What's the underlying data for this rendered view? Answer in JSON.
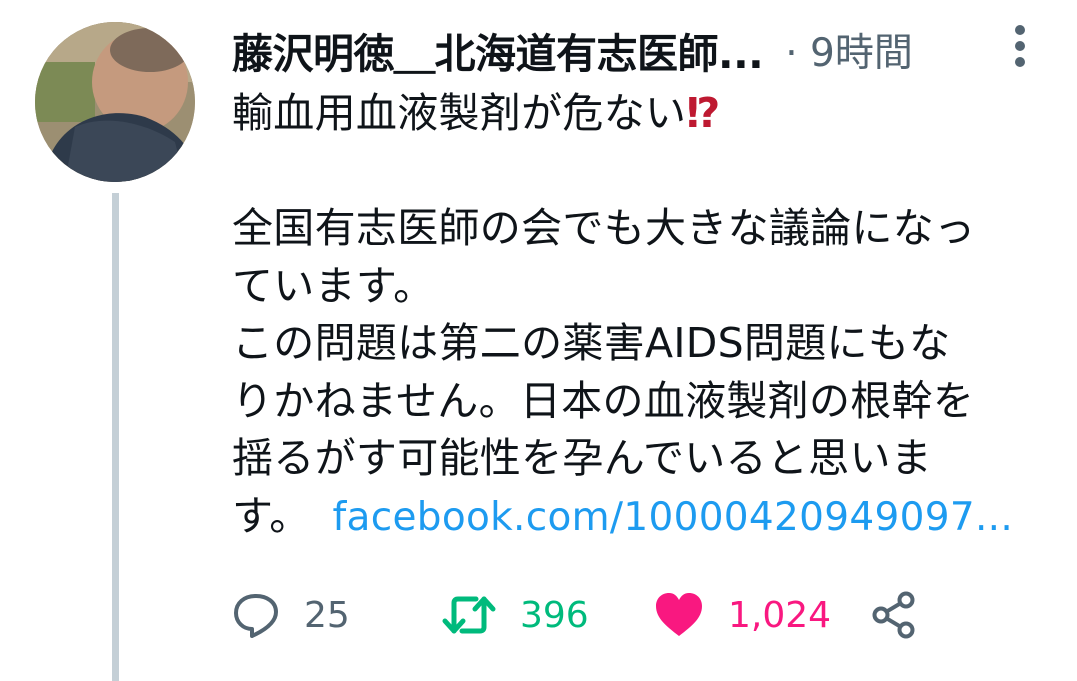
{
  "tweet": {
    "author_name": "藤沢明徳＿北海道有志医師...",
    "time": "· 9時間",
    "text_line1": "輸血用血液製剤が危ない",
    "emoji": "⁉",
    "text_paragraph2_lines": [
      "全国有志医師の会でも大きな議論になっ",
      "ています。",
      "この問題は第二の薬害AIDS問題にもな",
      "りかねません。日本の血液製剤の根幹を",
      "揺るがす可能性を孕んでいると思いま"
    ],
    "text_last": "す。",
    "link": "facebook.com/10000420949097..."
  },
  "actions": {
    "reply_count": "25",
    "retweet_count": "396",
    "like_count": "1,024"
  },
  "colors": {
    "link": "#1d9bf0",
    "retweet": "#00ba7c",
    "like": "#f91880",
    "secondary": "#536471",
    "thread_line": "#c4cfd6"
  }
}
